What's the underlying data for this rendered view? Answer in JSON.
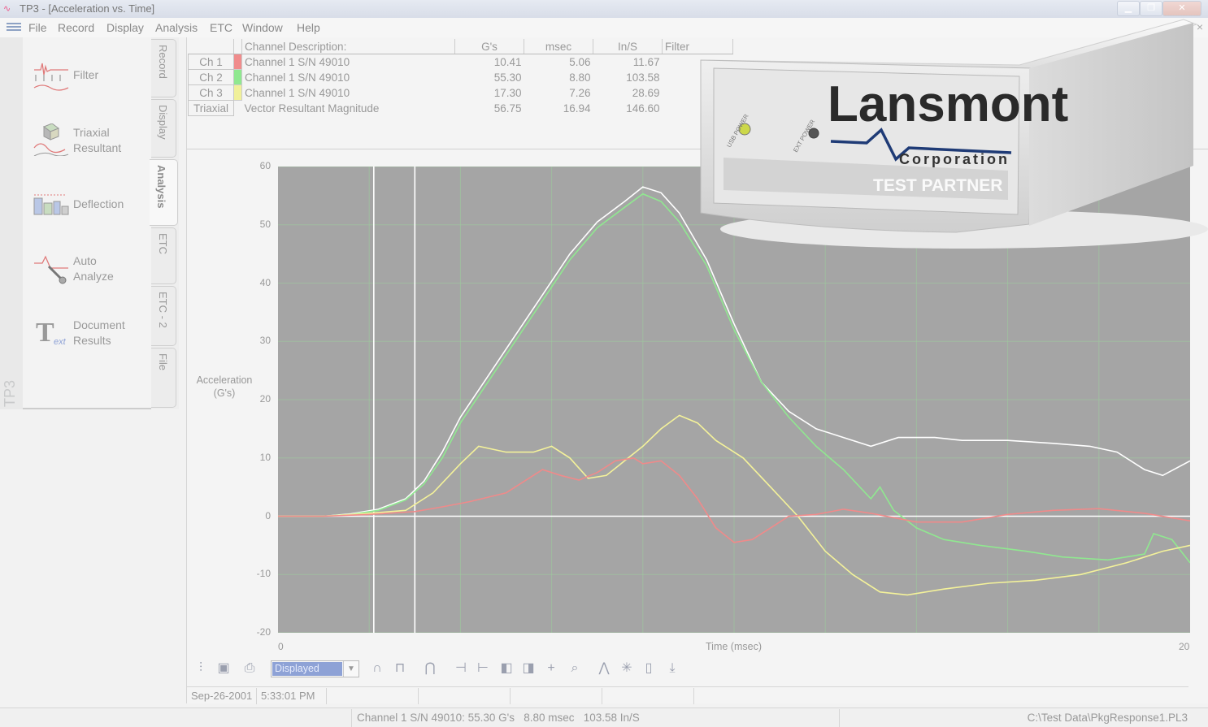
{
  "window": {
    "title": "TP3 - [Acceleration vs. Time]",
    "app_icon": "waveform-icon",
    "controls": [
      "minimize-icon",
      "restore-icon",
      "close-icon"
    ]
  },
  "menu": {
    "items": [
      {
        "label": "File"
      },
      {
        "label": "Record"
      },
      {
        "label": "Display"
      },
      {
        "label": "Analysis"
      },
      {
        "label": "ETC"
      },
      {
        "label": "Window"
      },
      {
        "label": "Help"
      }
    ],
    "close_glyph": "×"
  },
  "sidebar": {
    "brand": "TP3",
    "tools": [
      {
        "line1": "Filter",
        "line2": "",
        "icon": "filter-icon"
      },
      {
        "line1": "Triaxial",
        "line2": "Resultant",
        "icon": "triaxial-resultant-icon"
      },
      {
        "line1": "Deflection",
        "line2": "",
        "icon": "deflection-icon"
      },
      {
        "line1": "Auto",
        "line2": "Analyze",
        "icon": "auto-analyze-icon"
      },
      {
        "line1": "Document",
        "line2": "Results",
        "icon": "document-text-icon"
      }
    ],
    "tabs": [
      {
        "label": "Record"
      },
      {
        "label": "Display"
      },
      {
        "label": "Analysis",
        "active": true
      },
      {
        "label": "ETC"
      },
      {
        "label": "ETC - 2"
      },
      {
        "label": "File"
      }
    ]
  },
  "channels": {
    "headers": {
      "description": "Channel Description:",
      "gs": "G's",
      "msec": "msec",
      "ins": "In/S",
      "filter": "Filter"
    },
    "rows": [
      {
        "ch": "Ch 1",
        "color": "#f08c8c",
        "desc": "Channel 1 S/N 49010",
        "gs": "10.41",
        "msec": "5.06",
        "ins": "11.67"
      },
      {
        "ch": "Ch 2",
        "color": "#90e890",
        "desc": "Channel 1 S/N 49010",
        "gs": "55.30",
        "msec": "8.80",
        "ins": "103.58"
      },
      {
        "ch": "Ch 3",
        "color": "#f0f09a",
        "desc": "Channel 1 S/N 49010",
        "gs": "17.30",
        "msec": "7.26",
        "ins": "28.69"
      },
      {
        "ch": "Triaxial",
        "color": "",
        "desc": "Vector Resultant Magnitude",
        "gs": "56.75",
        "msec": "16.94",
        "ins": "146.60"
      }
    ]
  },
  "device": {
    "brand": "Lansmont",
    "subbrand": "Corporation",
    "product": "TEST PARTNER",
    "usb_label": "USB POWER",
    "ext_label": "EXT POWER"
  },
  "chart_data": {
    "type": "line",
    "title": "",
    "xlabel": "Time (msec)",
    "ylabel_line1": "Acceleration",
    "ylabel_line2": "(G's)",
    "xlim": [
      0,
      20
    ],
    "ylim": [
      -20,
      60
    ],
    "y_ticks": [
      60,
      50,
      40,
      30,
      20,
      10,
      0,
      -10,
      -20
    ],
    "x_ticks": [
      0,
      20
    ],
    "grid": true,
    "cursors_x": [
      2.1,
      3.0
    ],
    "series": [
      {
        "color": "#ffffff",
        "points": [
          [
            0,
            0
          ],
          [
            1,
            0
          ],
          [
            1.6,
            0.4
          ],
          [
            2.2,
            1.2
          ],
          [
            2.8,
            3
          ],
          [
            3.2,
            6
          ],
          [
            3.6,
            11
          ],
          [
            4,
            17
          ],
          [
            4.6,
            24
          ],
          [
            5.2,
            31
          ],
          [
            5.8,
            38
          ],
          [
            6.4,
            45
          ],
          [
            7,
            50.5
          ],
          [
            7.6,
            54
          ],
          [
            8,
            56.5
          ],
          [
            8.4,
            55.5
          ],
          [
            8.8,
            52
          ],
          [
            9.4,
            44
          ],
          [
            10,
            33
          ],
          [
            10.6,
            23
          ],
          [
            11.2,
            18
          ],
          [
            11.8,
            15
          ],
          [
            12.4,
            13.5
          ],
          [
            13,
            12
          ],
          [
            13.6,
            13.5
          ],
          [
            14.4,
            13.5
          ],
          [
            15,
            13
          ],
          [
            16,
            13
          ],
          [
            17,
            12.5
          ],
          [
            17.8,
            12
          ],
          [
            18.4,
            11
          ],
          [
            19,
            8
          ],
          [
            19.4,
            7
          ],
          [
            20,
            9.5
          ]
        ]
      },
      {
        "color": "#90e890",
        "points": [
          [
            0,
            0
          ],
          [
            1,
            0
          ],
          [
            1.6,
            0.3
          ],
          [
            2.2,
            1
          ],
          [
            2.8,
            2.8
          ],
          [
            3.2,
            5.5
          ],
          [
            3.6,
            10
          ],
          [
            4,
            16
          ],
          [
            4.6,
            23
          ],
          [
            5.2,
            30
          ],
          [
            5.8,
            37
          ],
          [
            6.4,
            44
          ],
          [
            7,
            49.5
          ],
          [
            7.6,
            53
          ],
          [
            8,
            55.3
          ],
          [
            8.4,
            54
          ],
          [
            8.8,
            50.5
          ],
          [
            9.4,
            43
          ],
          [
            10,
            32
          ],
          [
            10.6,
            23
          ],
          [
            11.2,
            17
          ],
          [
            11.8,
            12
          ],
          [
            12.4,
            8
          ],
          [
            13,
            3
          ],
          [
            13.2,
            5
          ],
          [
            13.5,
            1
          ],
          [
            14,
            -2
          ],
          [
            14.6,
            -4
          ],
          [
            15.4,
            -5
          ],
          [
            16.4,
            -6
          ],
          [
            17.2,
            -7
          ],
          [
            18.2,
            -7.5
          ],
          [
            19,
            -6.5
          ],
          [
            19.2,
            -3
          ],
          [
            19.6,
            -4
          ],
          [
            20,
            -8
          ]
        ]
      },
      {
        "color": "#f4f29a",
        "points": [
          [
            0,
            0
          ],
          [
            1,
            0
          ],
          [
            2,
            0.5
          ],
          [
            2.8,
            1
          ],
          [
            3.4,
            4
          ],
          [
            4,
            9
          ],
          [
            4.4,
            12
          ],
          [
            5,
            11
          ],
          [
            5.6,
            11
          ],
          [
            6,
            12
          ],
          [
            6.4,
            10
          ],
          [
            6.8,
            6.5
          ],
          [
            7.2,
            7
          ],
          [
            7.6,
            9.5
          ],
          [
            8,
            12
          ],
          [
            8.4,
            15
          ],
          [
            8.8,
            17.3
          ],
          [
            9.2,
            16
          ],
          [
            9.6,
            13
          ],
          [
            10.2,
            10
          ],
          [
            10.8,
            5
          ],
          [
            11.4,
            0
          ],
          [
            12,
            -6
          ],
          [
            12.6,
            -10
          ],
          [
            13.2,
            -13
          ],
          [
            13.8,
            -13.5
          ],
          [
            14.6,
            -12.5
          ],
          [
            15.6,
            -11.5
          ],
          [
            16.6,
            -11
          ],
          [
            17.6,
            -10
          ],
          [
            18.6,
            -8
          ],
          [
            19.4,
            -6
          ],
          [
            20,
            -5
          ]
        ]
      },
      {
        "color": "#f08a8a",
        "points": [
          [
            0,
            0
          ],
          [
            1,
            0
          ],
          [
            2,
            0.3
          ],
          [
            3,
            0.8
          ],
          [
            3.6,
            1.6
          ],
          [
            4.2,
            2.5
          ],
          [
            5,
            4
          ],
          [
            5.4,
            6
          ],
          [
            5.8,
            8
          ],
          [
            6.2,
            7
          ],
          [
            6.6,
            6.2
          ],
          [
            7,
            7.5
          ],
          [
            7.4,
            9.5
          ],
          [
            7.8,
            10
          ],
          [
            8,
            9
          ],
          [
            8.4,
            9.5
          ],
          [
            8.8,
            7
          ],
          [
            9.2,
            3
          ],
          [
            9.6,
            -2
          ],
          [
            10,
            -4.5
          ],
          [
            10.4,
            -4
          ],
          [
            10.8,
            -2
          ],
          [
            11.2,
            0
          ],
          [
            11.8,
            0.3
          ],
          [
            12.4,
            1.2
          ],
          [
            13,
            0.5
          ],
          [
            14,
            -1
          ],
          [
            15,
            -1
          ],
          [
            16,
            0.3
          ],
          [
            17,
            1
          ],
          [
            18,
            1.3
          ],
          [
            19,
            0.5
          ],
          [
            20,
            -0.8
          ]
        ]
      }
    ]
  },
  "toolbar": {
    "left_icons": [
      "chart-props-icon",
      "copy-image-icon",
      "print-icon"
    ],
    "view_select": "Displayed",
    "right_icons": [
      "half-sine-icon",
      "square-pulse-icon",
      "trapezoid-icon",
      "cursor-left-icon",
      "cursor-right-icon",
      "fill-left-icon",
      "fill-right-icon",
      "crosshair-icon",
      "zoom-icon",
      "peak-icon",
      "sparkle-icon",
      "window-icon",
      "export-icon"
    ]
  },
  "status": {
    "date": "Sep-26-2001",
    "time": "5:33:01 PM",
    "cursor_readout": "Channel 1 S/N 49010: 55.30 G's   8.80 msec   103.58 In/S",
    "file_path": "C:\\Test Data\\PkgResponse1.PL3"
  }
}
